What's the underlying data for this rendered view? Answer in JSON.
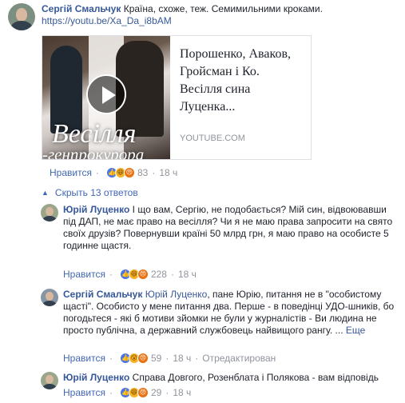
{
  "comment": {
    "author": "Сергій Смальчук",
    "text": "Країна, схоже, теж. Семимильними кроками.",
    "link": "https://youtu.be/Xa_Da_i8bAM",
    "preview": {
      "title": "Порошенко, Аваков, Гройсман і Ко. Весілля сина Луценка...",
      "domain": "YOUTUBE.COM",
      "thumb_line1": "Весілля",
      "thumb_line2": "-генпрокурора"
    },
    "like_label": "Нравится",
    "reaction_count": "83",
    "time": "18 ч"
  },
  "replies_toggle": "Скрыть 13 ответов",
  "replies": [
    {
      "author": "Юрій Луценко",
      "text": "І що вам, Сергію, не подобається? Мій син, відвоювавши під ДАП, не має право на весілля? Чи я не маю права запросити на свято своїх друзів? Повернувши країні 50 млрд грн, я маю право на особисте 5 годинне щастя.",
      "like_label": "Нравится",
      "reaction_count": "228",
      "time": "18 ч"
    },
    {
      "author": "Сергій Смальчук",
      "mention": "Юрій Луценко",
      "text": ", пане Юрію, питання не в \"особистому щасті\". Особисто у мене питання два. Перше - в поведінці УДО-шників, бо погодьтеся - які б мотиви зйомки не були у журналістів - Ви людина не просто публічна, а державний службовець найвищого рангу. ...",
      "more": "Еще",
      "like_label": "Нравится",
      "reaction_count": "59",
      "time": "18 ч",
      "edited": "Отредактирован"
    },
    {
      "author": "Юрій Луценко",
      "text": "Справа Довгого, Розенблата і Полякова - вам відповідь",
      "like_label": "Нравится",
      "reaction_count": "29",
      "time": "18 ч"
    }
  ],
  "colors": {
    "name": "#365899",
    "action": "#4267b2",
    "muted": "#90949c",
    "like": "#4a76e8",
    "haha": "#f7b125",
    "angry": "#e9710f"
  }
}
